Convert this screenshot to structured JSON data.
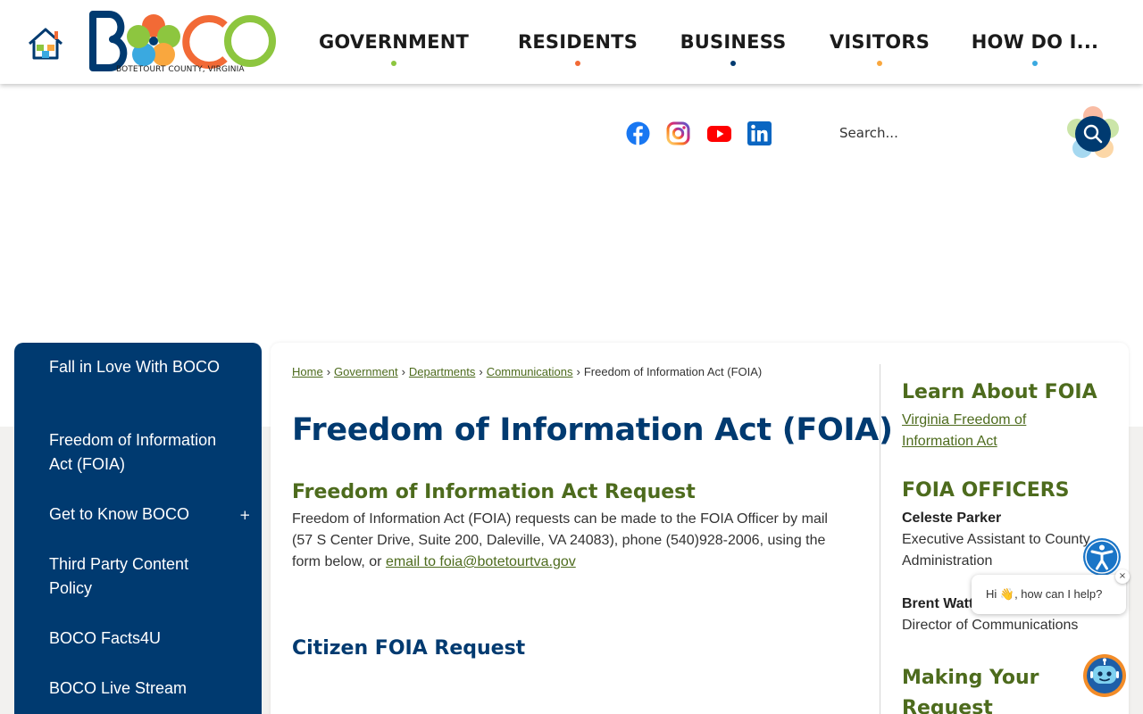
{
  "header": {
    "logo_tagline": "BOTETOURT COUNTY, VIRGINIA",
    "nav": [
      {
        "label": "GOVERNMENT",
        "dot_color": "#8dc63f"
      },
      {
        "label": "RESIDENTS",
        "dot_color": "#f26a36"
      },
      {
        "label": "BUSINESS",
        "dot_color": "#003a70"
      },
      {
        "label": "VISITORS",
        "dot_color": "#f9a73e"
      },
      {
        "label": "HOW DO I...",
        "dot_color": "#3aa9e0"
      }
    ]
  },
  "social": [
    "facebook-icon",
    "instagram-icon",
    "youtube-icon",
    "linkedin-icon"
  ],
  "search": {
    "placeholder": "Search..."
  },
  "sidebar": {
    "items": [
      {
        "label": "Fall in Love With BOCO"
      },
      {
        "label": "Freedom of Information Act (FOIA)"
      },
      {
        "label": "Get to Know BOCO",
        "toggle": "+"
      },
      {
        "label": "Third Party Content Policy"
      },
      {
        "label": "BOCO Facts4U"
      },
      {
        "label": "BOCO Live Stream"
      }
    ]
  },
  "breadcrumb": {
    "links": [
      "Home",
      "Government",
      "Departments",
      "Communications"
    ],
    "current": "Freedom of Information Act (FOIA)"
  },
  "main": {
    "title": "Freedom of Information Act (FOIA)",
    "request_heading": "Freedom of Information Act Request",
    "request_text": "Freedom of Information Act (FOIA) requests can be made to the FOIA Officer by mail (57 S Center Drive, Suite 200, Daleville, VA 24083), phone (540)928-2006, using the form below, or ",
    "request_link": "email to foia@botetourtva.gov",
    "form_heading": "Citizen FOIA Request"
  },
  "right_column": {
    "learn_heading": "Learn About FOIA",
    "learn_link": "Virginia Freedom of Information Act",
    "officers_heading": "FOIA OFFICERS",
    "officers": [
      {
        "name": "Celeste Parker",
        "role": "Executive Assistant to County Administration"
      },
      {
        "name": "Brent Watts",
        "role": "Director of Communications"
      }
    ],
    "making_heading": "Making Your Request"
  },
  "chat": {
    "greeting": "Hi 👋, how can I help?",
    "close": "×"
  },
  "colors": {
    "navy": "#003a70",
    "green": "#4d6b1d",
    "lime": "#8dc63f",
    "orange": "#f26a36",
    "yellow": "#f9a73e",
    "sky": "#3aa9e0"
  }
}
